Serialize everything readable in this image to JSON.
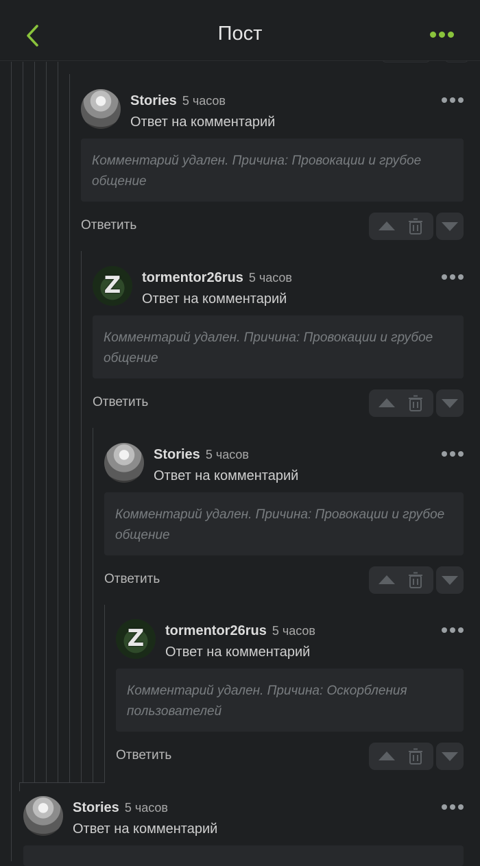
{
  "header": {
    "title": "Пост"
  },
  "comments": [
    {
      "author": "Stories",
      "time": "5 часов",
      "subtitle": "Ответ на комментарий",
      "deleted": "Комментарий удален. Причина: Провокации и грубое общение",
      "reply": "Ответить",
      "avatar": "stories"
    },
    {
      "author": "tormentor26rus",
      "time": "5 часов",
      "subtitle": "Ответ на комментарий",
      "deleted": "Комментарий удален. Причина: Провокации и грубое общение",
      "reply": "Ответить",
      "avatar": "z",
      "avatar_letter": "Z"
    },
    {
      "author": "Stories",
      "time": "5 часов",
      "subtitle": "Ответ на комментарий",
      "deleted": "Комментарий удален. Причина: Провокации и грубое общение",
      "reply": "Ответить",
      "avatar": "stories"
    },
    {
      "author": "tormentor26rus",
      "time": "5 часов",
      "subtitle": "Ответ на комментарий",
      "deleted": "Комментарий удален. Причина: Оскорбления пользователей",
      "reply": "Ответить",
      "avatar": "z",
      "avatar_letter": "Z"
    },
    {
      "author": "Stories",
      "time": "5 часов",
      "subtitle": "Ответ на комментарий",
      "avatar": "stories"
    }
  ],
  "colors": {
    "accent": "#8ac33c",
    "background": "#1e2022",
    "deleted_bg": "#27292c"
  },
  "icons": [
    "back-chevron-icon",
    "more-dots-icon",
    "upvote-icon",
    "trash-icon",
    "downvote-icon"
  ]
}
